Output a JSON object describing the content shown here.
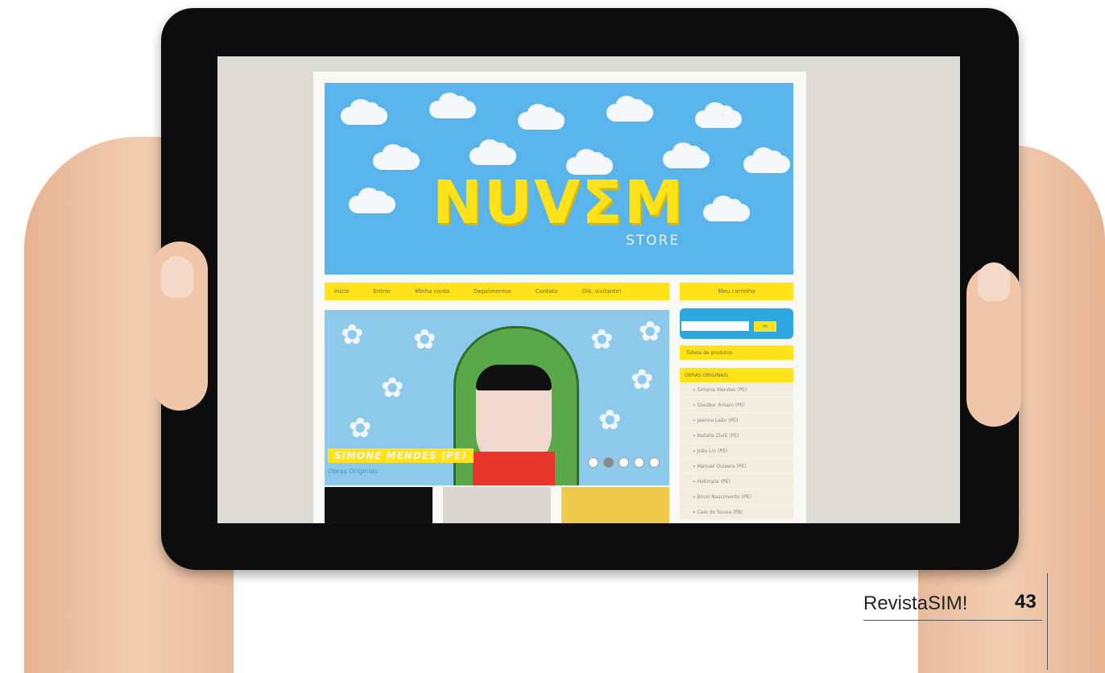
{
  "site": {
    "logo": "NUVΣM",
    "logo_sub": "STORE",
    "nav": [
      "Início",
      "Entrar",
      "Minha conta",
      "Depoimentos",
      "Contato",
      "Olá, visitante!"
    ],
    "cart": "Meu carrinho",
    "search": {
      "placeholder": "",
      "button": "ok"
    },
    "tabela": "Tabela de produtos",
    "obras_header": "OBRAS ORIGINAIS",
    "obras": [
      "» Simone Mendes (PE)",
      "» Glauber Amaro (PE)",
      "» Jeanne Leão (PE)",
      "» Natalia Ziviê (PE)",
      "» João Lin (PE)",
      "» Manuel Quixera (PE)",
      "» Hotimple (PE)",
      "» Bruxi Nascimento (PE)",
      "» Caio do Sousa (PB)"
    ],
    "hero": {
      "title": "SIMONE MENDES (PE)",
      "subtitle": "Obras Originais"
    }
  },
  "magazine": {
    "name": "RevistaSIM!",
    "page": "43"
  },
  "colors": {
    "accent": "#ffe21a",
    "sky": "#58b4ea",
    "search": "#2ea6df"
  }
}
